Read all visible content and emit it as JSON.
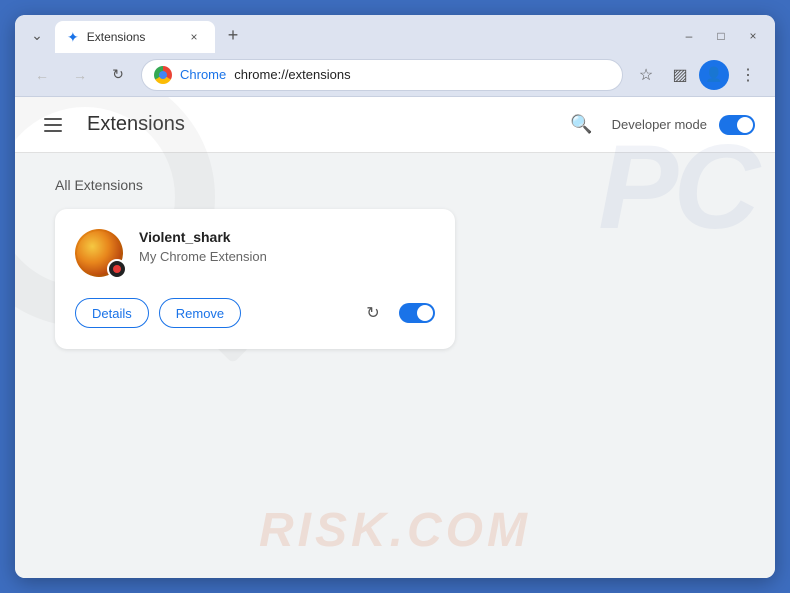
{
  "window": {
    "title": "Extensions",
    "tab_label": "Extensions",
    "close_label": "×",
    "minimize_label": "–",
    "maximize_label": "□",
    "new_tab_label": "+"
  },
  "toolbar": {
    "back_tooltip": "Back",
    "forward_tooltip": "Forward",
    "reload_tooltip": "Reload",
    "chrome_label": "Chrome",
    "address": "chrome://extensions",
    "star_tooltip": "Bookmark",
    "extensions_tooltip": "Extensions",
    "profile_tooltip": "Profile",
    "menu_tooltip": "Menu"
  },
  "extensions_page": {
    "hamburger_tooltip": "Menu",
    "title": "Extensions",
    "search_tooltip": "Search extensions",
    "developer_mode_label": "Developer mode",
    "developer_mode_on": true,
    "section_title": "All Extensions"
  },
  "extension_card": {
    "name": "Violent_shark",
    "description": "My Chrome Extension",
    "details_label": "Details",
    "remove_label": "Remove",
    "reload_tooltip": "Reload",
    "enabled": true
  },
  "watermark": {
    "pc_text": "PC",
    "risk_text": "RISK.COM"
  }
}
